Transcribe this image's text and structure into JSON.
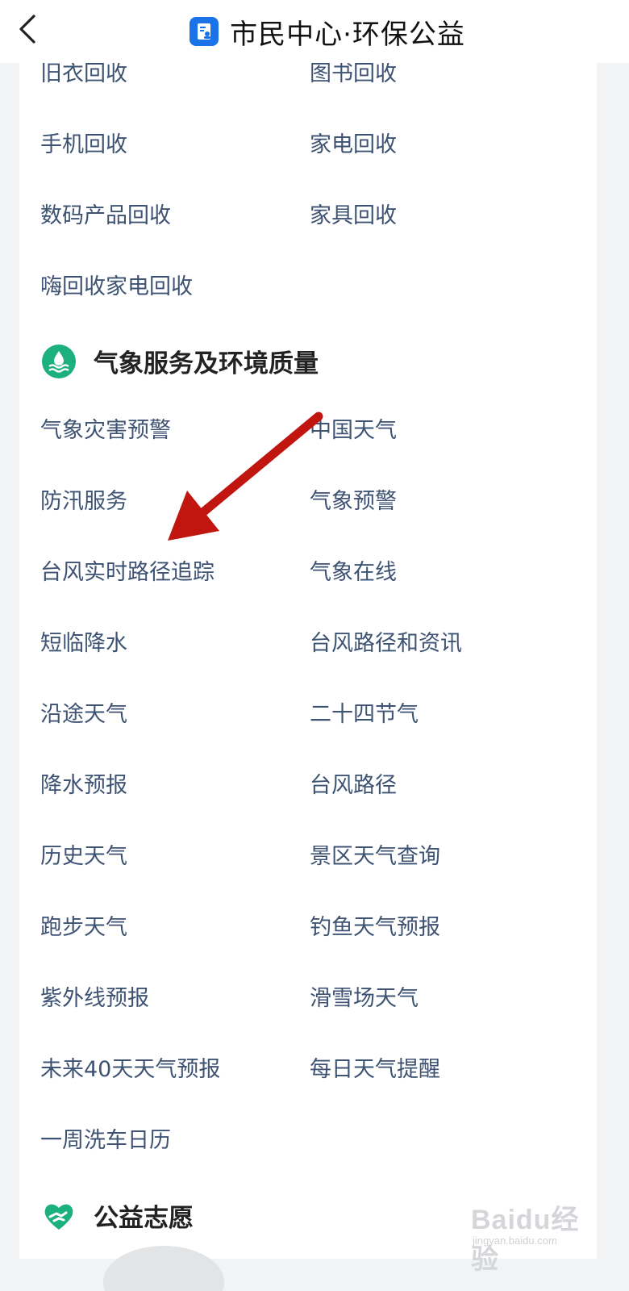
{
  "header": {
    "title": "市民中心·环保公益",
    "back_icon": "chevron-left-icon",
    "app_icon": "citizen-center-icon",
    "accent_color": "#1a73e8"
  },
  "recycling": {
    "items": [
      "旧衣回收",
      "图书回收",
      "手机回收",
      "家电回收",
      "数码产品回收",
      "家具回收",
      "嗨回收家电回收"
    ]
  },
  "weather_section": {
    "title": "气象服务及环境质量",
    "icon": "water-wave-icon",
    "icon_color": "#1bb07d",
    "items": [
      "气象灾害预警",
      "中国天气",
      "防汛服务",
      "气象预警",
      "台风实时路径追踪",
      "气象在线",
      "短临降水",
      "台风路径和资讯",
      "沿途天气",
      "二十四节气",
      "降水预报",
      "台风路径",
      "历史天气",
      "景区天气查询",
      "跑步天气",
      "钓鱼天气预报",
      "紫外线预报",
      "滑雪场天气",
      "未来40天天气预报",
      "每日天气提醒",
      "一周洗车日历"
    ]
  },
  "volunteer_section": {
    "title": "公益志愿",
    "icon": "heart-hand-icon",
    "icon_color": "#1bb07d"
  },
  "annotation": {
    "arrow_color": "#c0160f",
    "arrow_icon": "red-arrow-annotation"
  },
  "watermark": {
    "logo_text": "Baidu经验",
    "sub_text": "jingyan.baidu.com"
  }
}
